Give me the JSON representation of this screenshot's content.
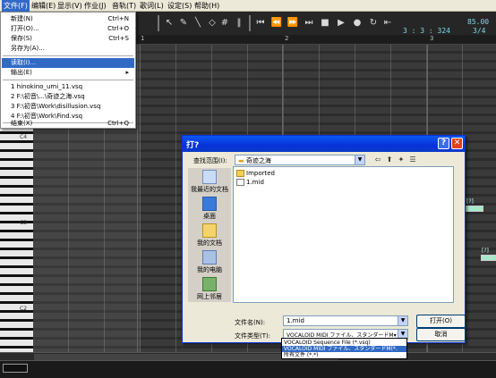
{
  "menubar": {
    "items": [
      "文件(F)",
      "编辑(E)",
      "显示(V)",
      "作业(J)",
      "音轨(T)",
      "歌词(L)",
      "设定(S)",
      "帮助(H)"
    ]
  },
  "lcd": {
    "position": "3 : 3 : 324",
    "tempo": "85.00",
    "beat": "3/4"
  },
  "ruler": {
    "ticks": [
      "1",
      "2",
      "3"
    ]
  },
  "piano": {
    "octaves": [
      "C4",
      "C3",
      "C2"
    ]
  },
  "notes": {
    "labels": [
      "[?]",
      "[?]"
    ]
  },
  "file_menu": {
    "items": [
      {
        "label": "新建(N)",
        "shortcut": "Ctrl+N"
      },
      {
        "label": "打开(O)...",
        "shortcut": "Ctrl+O"
      },
      {
        "label": "保存(S)",
        "shortcut": "Ctrl+S"
      },
      {
        "label": "另存为(A)...",
        "shortcut": ""
      },
      {
        "label": "读取(I)...",
        "shortcut": ""
      },
      {
        "label": "输出(E)",
        "shortcut": "▸"
      },
      {
        "label": "1 hinokino_umi_11.vsq",
        "shortcut": ""
      },
      {
        "label": "2 F:\\初音\\...\\奇迹之海.vsq",
        "shortcut": ""
      },
      {
        "label": "3 F:\\初音\\Work\\disillusion.vsq",
        "shortcut": ""
      },
      {
        "label": "4 F:\\初音\\Work\\Find.vsq",
        "shortcut": ""
      },
      {
        "label": "结束(X)",
        "shortcut": "Ctrl+Q"
      }
    ]
  },
  "dialog": {
    "title": "打?",
    "look_in_label": "查找范围(I):",
    "look_in_value": "奇迹之海",
    "places": [
      "我最近的文档",
      "桌面",
      "我的文档",
      "我的电脑",
      "网上邻居"
    ],
    "files": [
      "Imported",
      "1.mid"
    ],
    "filename_label": "文件名(N):",
    "filename_value": "1.mid",
    "filetype_label": "文件类型(T):",
    "filetype_value": "VOCALOID MIDI ファイル、スタンダードM▾",
    "open_button": "打开(O)",
    "cancel_button": "取消",
    "help_button": "?",
    "close_button": "✕",
    "filetype_options": [
      "VOCALOID Sequence File (*.vsq)",
      "VOCALOID MIDI ファイル、スタンダードM(*.",
      "所有文件 (*.*)"
    ]
  },
  "colors": {
    "accent": "#316ac5",
    "titlebar": "#0831d9",
    "lcd_text": "#7fd8e8"
  }
}
